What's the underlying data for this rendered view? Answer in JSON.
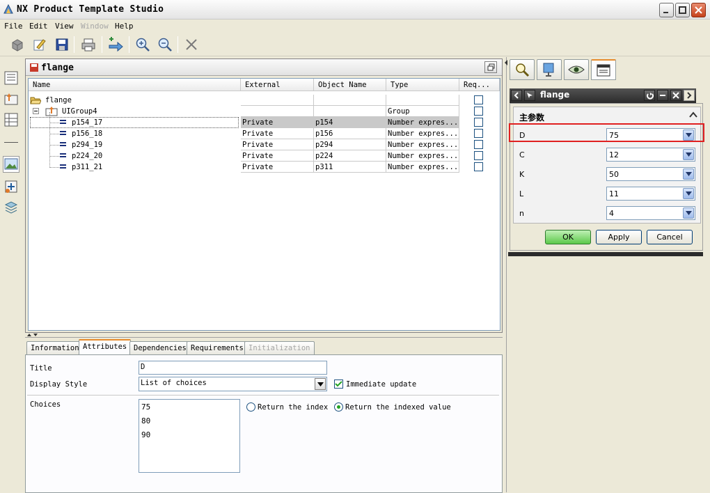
{
  "window": {
    "title": "NX Product Template Studio",
    "accent": "#e68b2c"
  },
  "menu": [
    "File",
    "Edit",
    "View",
    "Window",
    "Help"
  ],
  "menu_disabled": [
    "Window"
  ],
  "toolbar_icons": [
    "cube-icon",
    "edit-icon",
    "save-icon",
    "print-icon",
    "add-step-icon",
    "zoom-in-icon",
    "zoom-out-icon",
    "delete-icon"
  ],
  "tree_panel": {
    "title": "flange",
    "columns": [
      "Name",
      "External",
      "Object Name",
      "Type",
      "Req..."
    ],
    "rows": [
      {
        "name": "flange",
        "external": "",
        "object": "",
        "type": "",
        "level": 0,
        "kind": "folder"
      },
      {
        "name": "UIGroup4",
        "external": "",
        "object": "",
        "type": "Group",
        "level": 1,
        "kind": "group"
      },
      {
        "name": "p154_17",
        "external": "Private",
        "object": "p154",
        "type": "Number expres...",
        "level": 2,
        "kind": "expr",
        "selected": true
      },
      {
        "name": "p156_18",
        "external": "Private",
        "object": "p156",
        "type": "Number expres...",
        "level": 2,
        "kind": "expr"
      },
      {
        "name": "p294_19",
        "external": "Private",
        "object": "p294",
        "type": "Number expres...",
        "level": 2,
        "kind": "expr"
      },
      {
        "name": "p224_20",
        "external": "Private",
        "object": "p224",
        "type": "Number expres...",
        "level": 2,
        "kind": "expr"
      },
      {
        "name": "p311_21",
        "external": "Private",
        "object": "p311",
        "type": "Number expres...",
        "level": 2,
        "kind": "expr"
      }
    ]
  },
  "bottom": {
    "tabs": [
      "Information",
      "Attributes",
      "Dependencies",
      "Requirements",
      "Initialization"
    ],
    "active_tab": "Attributes",
    "title_label": "Title",
    "title_value": "D",
    "display_label": "Display Style",
    "display_value": "List of choices",
    "immediate_label": "Immediate update",
    "choices_label": "Choices",
    "choices": [
      "75",
      "80",
      "90"
    ],
    "radio_index_label": "Return the index",
    "radio_value_label": "Return the indexed value"
  },
  "right_panel": {
    "dialog_title": "flange",
    "group_title": "主参数",
    "params": [
      {
        "label": "D",
        "value": "75",
        "highlighted": true
      },
      {
        "label": "C",
        "value": "12"
      },
      {
        "label": "K",
        "value": "50"
      },
      {
        "label": "L",
        "value": "11"
      },
      {
        "label": "n",
        "value": "4"
      }
    ],
    "ok_label": "OK",
    "apply_label": "Apply",
    "cancel_label": "Cancel"
  }
}
